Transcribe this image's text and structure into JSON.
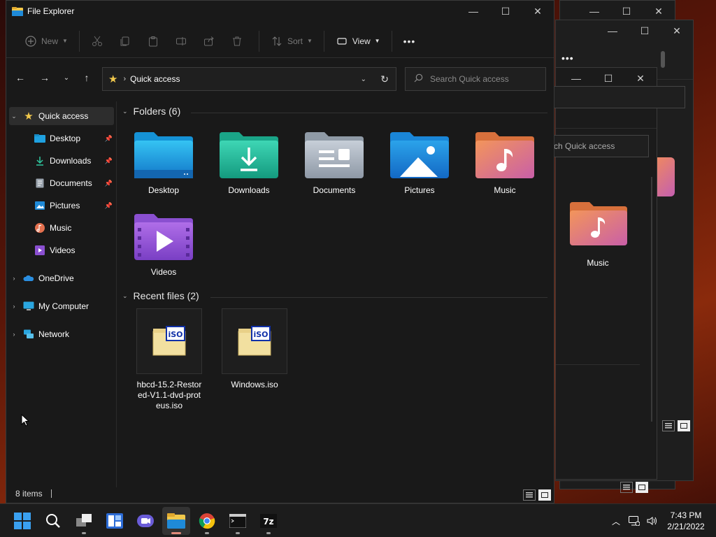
{
  "background_windows": {
    "more_label": "•••",
    "search_partial": "ch Quick access",
    "music_label": "Music"
  },
  "window": {
    "title": "File Explorer",
    "controls": {
      "minimize": "—",
      "maximize": "☐",
      "close": "✕"
    }
  },
  "toolbar": {
    "new_label": "New",
    "sort_label": "Sort",
    "view_label": "View",
    "more_label": "•••"
  },
  "address": {
    "location": "Quick access",
    "search_placeholder": "Search Quick access"
  },
  "sidebar": {
    "quick_access": "Quick access",
    "items": [
      {
        "label": "Desktop",
        "pinned": true
      },
      {
        "label": "Downloads",
        "pinned": true
      },
      {
        "label": "Documents",
        "pinned": true
      },
      {
        "label": "Pictures",
        "pinned": true
      },
      {
        "label": "Music",
        "pinned": false
      },
      {
        "label": "Videos",
        "pinned": false
      }
    ],
    "onedrive": "OneDrive",
    "my_computer": "My Computer",
    "network": "Network"
  },
  "content": {
    "folders_header": "Folders (6)",
    "folders": [
      "Desktop",
      "Downloads",
      "Documents",
      "Pictures",
      "Music",
      "Videos"
    ],
    "recent_header": "Recent files (2)",
    "recent_files": [
      {
        "name": "hbcd-15.2-Restored-V1.1-dvd-proteus.iso",
        "line1": "hbcd-15.2-Restor",
        "line2": "ed-V1.1-dvd-prot",
        "line3": "eus.iso"
      },
      {
        "name": "Windows.iso",
        "line1": "Windows.iso",
        "line2": "",
        "line3": ""
      }
    ]
  },
  "status": {
    "items": "8 items"
  },
  "taskbar": {
    "clock_time": "7:43 PM",
    "clock_date": "2/21/2022"
  },
  "colors": {
    "accent_folder_yellow": "#f2c94c",
    "selected_bg": "#2d2d2d",
    "window_bg": "#191919"
  }
}
